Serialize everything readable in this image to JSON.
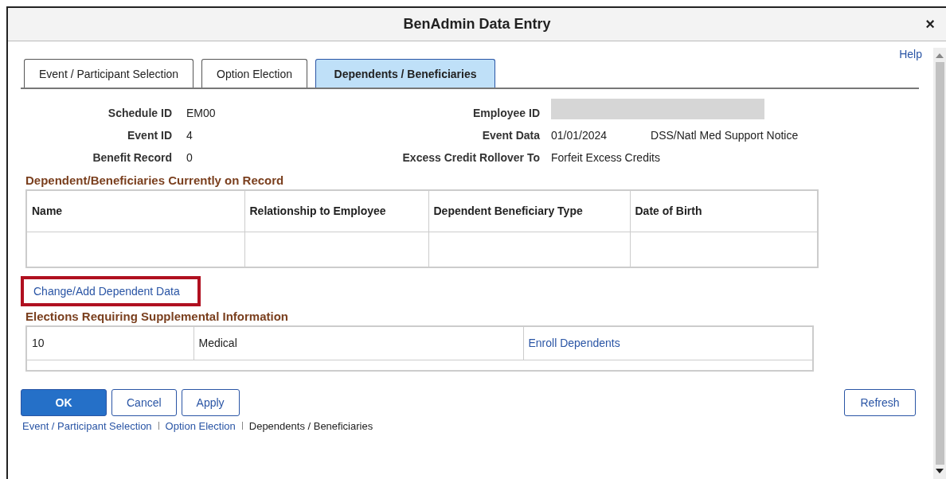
{
  "window": {
    "title": "BenAdmin Data Entry",
    "close": "×"
  },
  "help": "Help",
  "tabs": [
    {
      "label": "Event / Participant Selection",
      "selected": false
    },
    {
      "label": "Option Election",
      "selected": false
    },
    {
      "label": "Dependents / Beneficiaries",
      "selected": true
    }
  ],
  "fields_left": [
    {
      "label": "Schedule ID",
      "value": "EM00"
    },
    {
      "label": "Event ID",
      "value": "4"
    },
    {
      "label": "Benefit Record",
      "value": "0"
    }
  ],
  "fields_right": [
    {
      "label": "Employee ID",
      "kind": "redacted"
    },
    {
      "label": "Event Data",
      "kind": "text",
      "value": "01/01/2024",
      "extra": "DSS/Natl Med Support Notice"
    },
    {
      "label": "Excess Credit Rollover To",
      "kind": "text",
      "value": "Forfeit Excess Credits"
    }
  ],
  "dependents": {
    "title": "Dependent/Beneficiaries Currently on Record",
    "columns": [
      "Name",
      "Relationship to Employee",
      "Dependent Beneficiary Type",
      "Date of Birth"
    ]
  },
  "change_link": {
    "label": "Change/Add Dependent Data",
    "highlighted": true
  },
  "elections": {
    "title": "Elections Requiring Supplemental Information",
    "rows": [
      {
        "column_1": "10",
        "column_2": "Medical",
        "link": "Enroll Dependents"
      }
    ]
  },
  "buttons": [
    {
      "label": "OK",
      "kind": "primary"
    },
    {
      "label": "Cancel",
      "kind": "secondary"
    },
    {
      "label": "Apply",
      "kind": "secondary"
    }
  ],
  "refresh": "Refresh",
  "breadcrumb": [
    {
      "label": "Event / Participant Selection",
      "kind": "link"
    },
    {
      "label": "Option Election",
      "kind": "link"
    },
    {
      "label": "Dependents / Beneficiaries",
      "kind": "current"
    }
  ]
}
